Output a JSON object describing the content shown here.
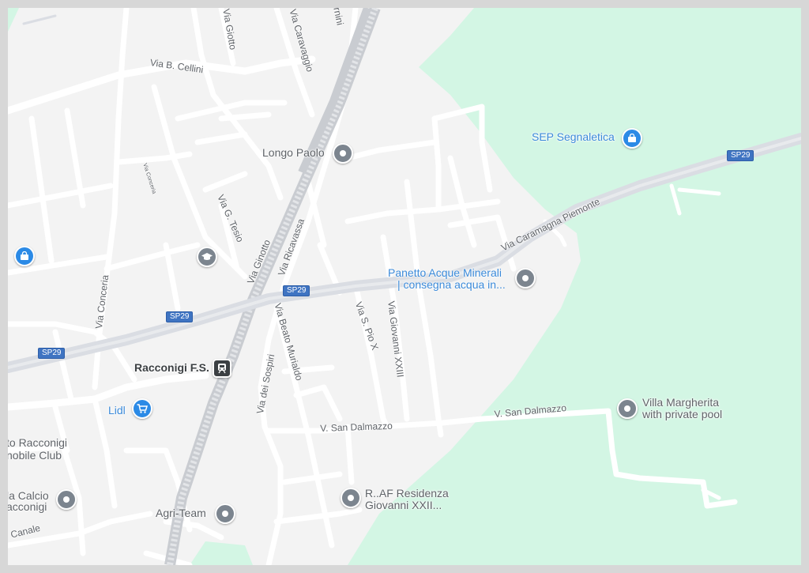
{
  "map": {
    "roads": {
      "via_b_cellini": "Via B. Cellini",
      "via_giotto": "Via Giotto",
      "via_caravaggio": "Via Caravaggio",
      "via_frag_top": "rnini",
      "via_g_tesio": "Via G. Tesio",
      "via_ginotto": "Via Ginotto",
      "via_ricavassa": "Via Ricavassa",
      "via_conceria": "Via Conceria",
      "via_conceria_small": "Via Conceria",
      "via_caramagna": "Via Caramagna Piemonte",
      "via_s_pio_x": "Via S. Pio X",
      "via_giovanni_xxiii": "Via Giovanni XXIII",
      "via_beato_murialdo": "Via Beato Murialdo",
      "via_dei_sospiri": "Via dei Sospiri",
      "v_san_dalmazzo_1": "V. San Dalmazzo",
      "v_san_dalmazzo_2": "V. San Dalmazzo",
      "via_canale": "Canale"
    },
    "shields": {
      "sp29": "SP29"
    },
    "pois": {
      "longo_paolo": "Longo Paolo",
      "sep_segnaletica": "SEP Segnaletica",
      "panetto_line1": "Panetto Acque Minerali",
      "panetto_line2": "| consegna acqua in...",
      "racconigi_fs": "Racconigi F.S.",
      "lidl": "Lidl",
      "villa_line1": "Villa Margherita",
      "villa_line2": "with private pool",
      "residenza_line1": "R..AF Residenza",
      "residenza_line2": "Giovanni XXII...",
      "agri_team": "Agri-Team",
      "moto_line1": "to Racconigi",
      "moto_line2": "nobile Club",
      "calcio_line1": "la Calcio",
      "calcio_line2": "acconigi"
    },
    "icons": {
      "poi": "location-pin-icon",
      "shop": "shopping-bag-icon",
      "cart": "shopping-cart-icon",
      "school": "graduation-cap-icon",
      "train": "train-icon"
    },
    "colors": {
      "land": "#f3f3f3",
      "park": "#d3f6e4",
      "road": "#ffffff",
      "highway": "#dadde3",
      "rail": "#c9ccd1",
      "poi_gray": "#7c858f",
      "poi_blue": "#2b8ae6",
      "shield": "#3f74c2"
    }
  }
}
